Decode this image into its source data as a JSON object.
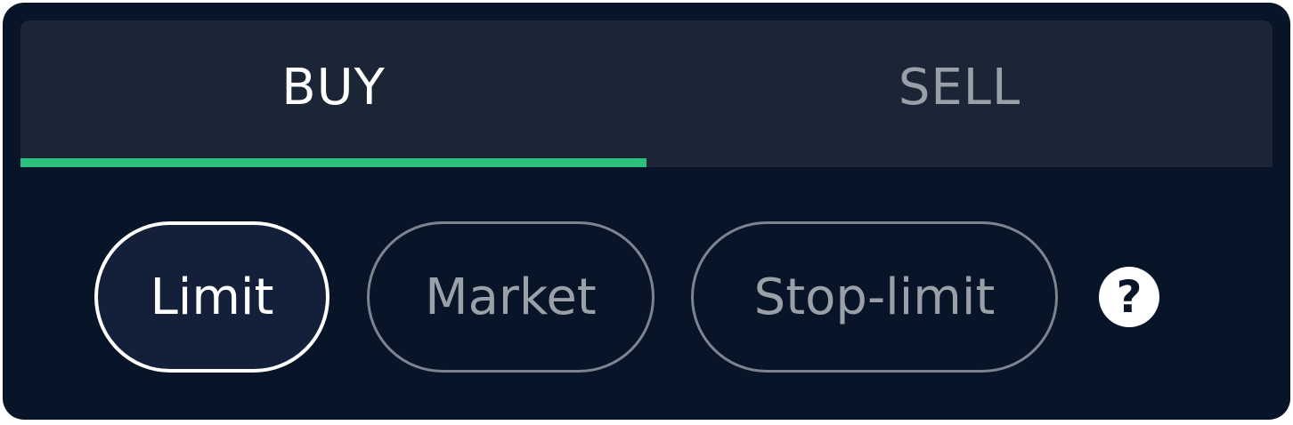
{
  "tabs": {
    "buy": {
      "label": "BUY",
      "active": true
    },
    "sell": {
      "label": "SELL",
      "active": false
    }
  },
  "order_types": {
    "limit": {
      "label": "Limit",
      "selected": true
    },
    "market": {
      "label": "Market",
      "selected": false
    },
    "stop_limit": {
      "label": "Stop-limit",
      "selected": false
    }
  },
  "help": {
    "icon": "question-icon",
    "glyph": "?"
  },
  "colors": {
    "panel_background": "#081428",
    "tab_background": "#1c2535",
    "active_indicator": "#2cc07e",
    "active_text": "#ffffff",
    "inactive_text": "#9aa0a8"
  }
}
